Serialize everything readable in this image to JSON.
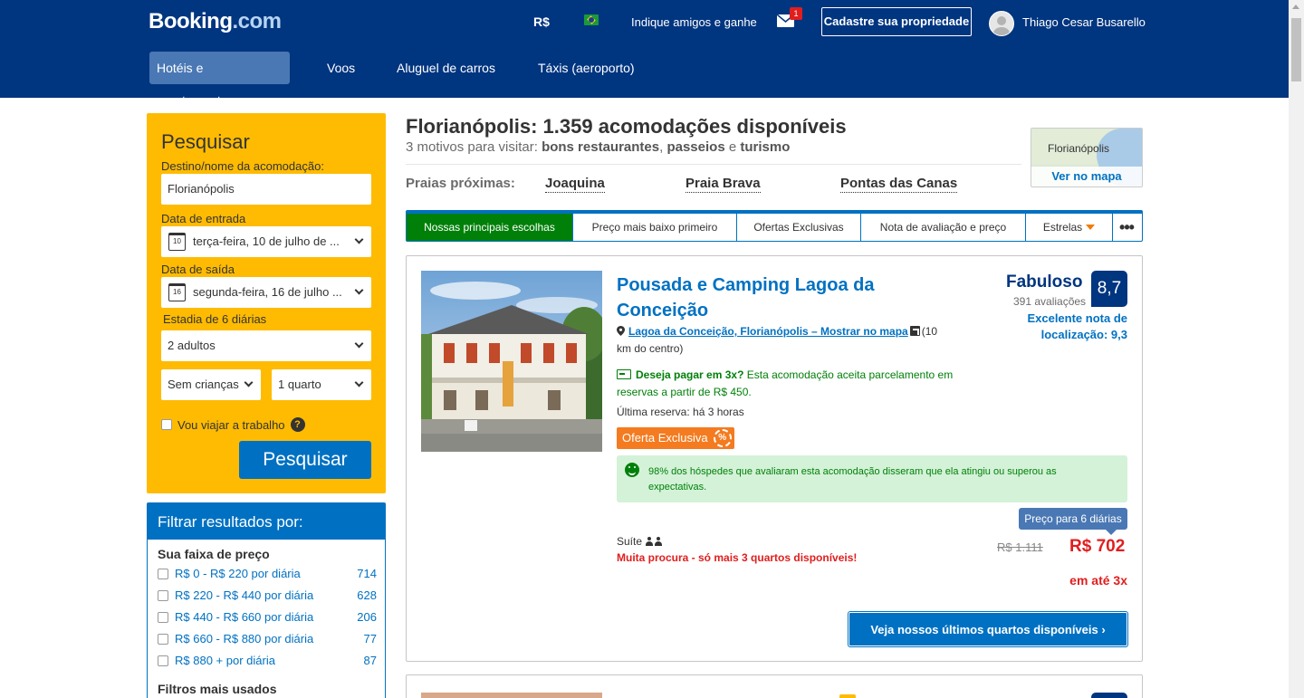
{
  "header": {
    "logo_main": "Booking",
    "logo_dotcom": ".com",
    "currency": "R$",
    "referral": "Indique amigos e ganhe",
    "mail_count": "1",
    "list_property": "Cadastre sua propriedade",
    "user_name": "Thiago Cesar Busarello",
    "nav": [
      {
        "label": "Hotéis e apartamentos",
        "active": true
      },
      {
        "label": "Voos"
      },
      {
        "label": "Aluguel de carros"
      },
      {
        "label": "Táxis (aeroporto)"
      }
    ]
  },
  "search": {
    "title": "Pesquisar",
    "destination_label": "Destino/nome da acomodação:",
    "destination_value": "Florianópolis",
    "checkin_label": "Data de entrada",
    "checkin_day": "10",
    "checkin_value": "terça-feira, 10 de julho de ...",
    "checkout_label": "Data de saída",
    "checkout_day": "16",
    "checkout_value": "segunda-feira, 16 de julho ...",
    "stay_label": "Estadia de 6 diárias",
    "adults": "2 adultos",
    "children": "Sem crianças",
    "rooms": "1 quarto",
    "work_trip": "Vou viajar a trabalho",
    "help": "?",
    "button": "Pesquisar"
  },
  "filters": {
    "title": "Filtrar resultados por:",
    "price_heading": "Sua faixa de preço",
    "price_ranges": [
      {
        "label": "R$ 0 - R$ 220 por diária",
        "count": "714"
      },
      {
        "label": "R$ 220 - R$ 440 por diária",
        "count": "628"
      },
      {
        "label": "R$ 440 - R$ 660 por diária",
        "count": "206"
      },
      {
        "label": "R$ 660 - R$ 880 por diária",
        "count": "77"
      },
      {
        "label": "R$ 880 + por diária",
        "count": "87"
      }
    ],
    "popular_heading": "Filtros mais usados"
  },
  "results": {
    "title": "Florianópolis: 1.359 acomodações disponíveis",
    "reasons_prefix": "3 motivos para visitar: ",
    "reason1": "bons restaurantes",
    "sep1": ", ",
    "reason2": "passeios",
    "sep2": " e ",
    "reason3": "turismo",
    "map_city": "Florianópolis",
    "map_link": "Ver no mapa",
    "beaches_label": "Praias próximas:",
    "beaches": [
      "Joaquina",
      "Praia Brava",
      "Pontas das Canas"
    ],
    "sort_tabs": [
      {
        "label": "Nossas principais escolhas",
        "active": true
      },
      {
        "label": "Preço mais baixo primeiro"
      },
      {
        "label": "Ofertas Exclusivas"
      },
      {
        "label": "Nota de avaliação e preço"
      },
      {
        "label": "Estrelas"
      },
      {
        "label": "•••"
      }
    ]
  },
  "hotel": {
    "name": "Pousada e Camping Lagoa da Conceição",
    "address_link": "Lagoa da Conceição, Florianópolis – Mostrar no mapa",
    "distance": "(10 km do centro)",
    "installment_bold": "Deseja pagar em 3x?",
    "installment_text": " Esta acomodação aceita parcelamento em reservas a partir de R$ 450.",
    "last_booking": "Última reserva: há 3 horas",
    "exclusive": "Oferta Exclusiva",
    "guest_message": "98% dos hóspedes que avaliaram esta acomodação disseram que ela atingiu ou superou as expectativas.",
    "rating_word": "Fabuloso",
    "reviews": "391 avaliações",
    "score": "8,7",
    "location_score": "Excelente nota de localização: 9,3",
    "price_tip": "Preço para 6 diárias",
    "room_type": "Suíte",
    "scarcity": "Muita procura - só mais 3 quartos disponíveis!",
    "old_price": "R$ 1.111",
    "price": "R$ 702",
    "installments": "em até 3x",
    "cta": "Veja nossos últimos quartos disponíveis ›"
  },
  "colors": {
    "brand_blue": "#003580",
    "link_blue": "#0071c2",
    "search_yellow": "#febb02",
    "green": "#008009",
    "red": "#e01e1e",
    "orange": "#f47b20"
  }
}
